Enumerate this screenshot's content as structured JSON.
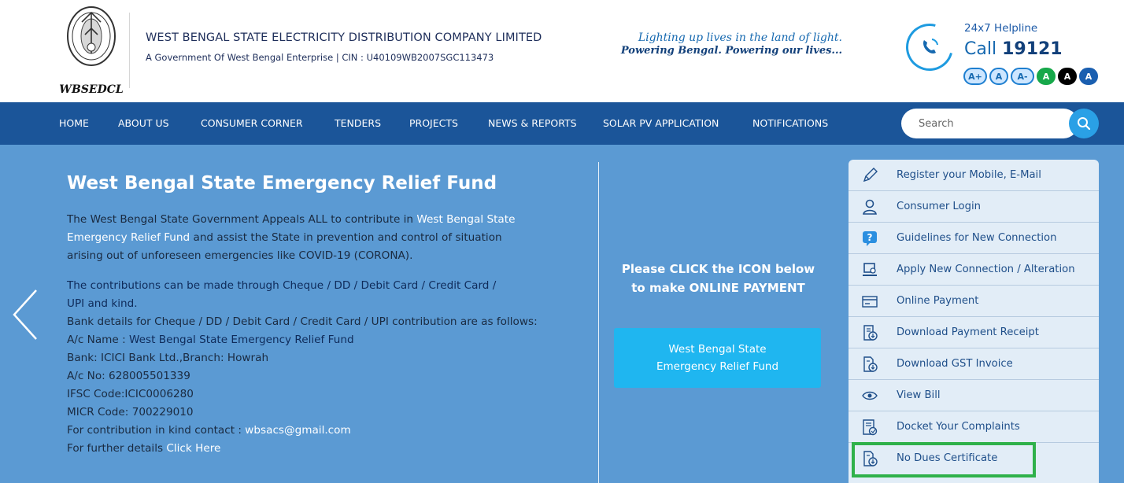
{
  "header": {
    "logo_text": "WBSEDCL",
    "company_name": "WEST BENGAL STATE ELECTRICITY DISTRIBUTION COMPANY LIMITED",
    "company_sub": "A Government Of West Bengal Enterprise | CIN : U40109WB2007SGC113473",
    "tagline_line1": "Lighting up lives in the land of light.",
    "tagline_line2": "Powering Bengal. Powering our lives...",
    "helpline_label": "24x7 Helpline",
    "helpline_call_prefix": "Call",
    "helpline_number": "19121",
    "font_buttons": [
      "A+",
      "A",
      "A-",
      "A",
      "A",
      "A"
    ]
  },
  "nav": {
    "items": [
      "HOME",
      "ABOUT US",
      "CONSUMER CORNER",
      "TENDERS",
      "PROJECTS",
      "NEWS & REPORTS",
      "SOLAR PV APPLICATION",
      "NOTIFICATIONS"
    ],
    "search_placeholder": "Search"
  },
  "hero": {
    "title": "West Bengal State Emergency Relief Fund",
    "p1_a": "The West Bengal State Government Appeals ALL to contribute in",
    "p1_link": "West Bengal State",
    "p1_link2": "Emergency Relief Fund",
    "p1_b": "and assist the State in prevention and control of situation",
    "p1_c": "arising out of unforeseen emergencies like COVID-19 (CORONA).",
    "contrib_1": "The contributions can be made through Cheque / DD / Debit Card / Credit Card /",
    "contrib_2": "UPI and kind.",
    "bank_intro": "Bank details for Cheque / DD / Debit Card / Credit Card / UPI contribution are as follows:",
    "ac_name_label": "A/c Name :",
    "ac_name_value": "West Bengal State Emergency Relief Fund",
    "bank": "Bank: ICICI Bank Ltd.,Branch: Howrah",
    "ac_no": "A/c No: 628005501339",
    "ifsc": "IFSC Code:ICIC0006280",
    "micr": "MICR Code: 700229010",
    "kind_contact_label": "For contribution in kind contact :",
    "kind_contact_email": "wbsacs@gmail.com",
    "further_label": "For further details",
    "further_link": "Click Here",
    "click_heading_1": "Please CLICK the ICON below",
    "click_heading_2": "to make ONLINE PAYMENT",
    "relief_btn_1": "West Bengal State",
    "relief_btn_2": "Emergency Relief Fund"
  },
  "quick_links": [
    {
      "label": "Register your Mobile, E-Mail",
      "icon": "pencil-icon"
    },
    {
      "label": "Consumer Login",
      "icon": "user-icon"
    },
    {
      "label": "Guidelines for New Connection",
      "icon": "help-icon"
    },
    {
      "label": "Apply New Connection / Alteration",
      "icon": "laptop-icon"
    },
    {
      "label": "Online Payment",
      "icon": "card-icon"
    },
    {
      "label": "Download Payment Receipt",
      "icon": "receipt-download-icon"
    },
    {
      "label": "Download GST Invoice",
      "icon": "invoice-download-icon"
    },
    {
      "label": "View Bill",
      "icon": "eye-icon"
    },
    {
      "label": "Docket Your Complaints",
      "icon": "docket-icon"
    },
    {
      "label": "No Dues Certificate",
      "icon": "certificate-icon"
    }
  ],
  "colors": {
    "nav_bg": "#1b5599",
    "hero_bg": "#5b9ad3",
    "relief_btn": "#1fb6f0",
    "highlight": "#2fb14a",
    "quick_panel": "#e2edf7"
  }
}
